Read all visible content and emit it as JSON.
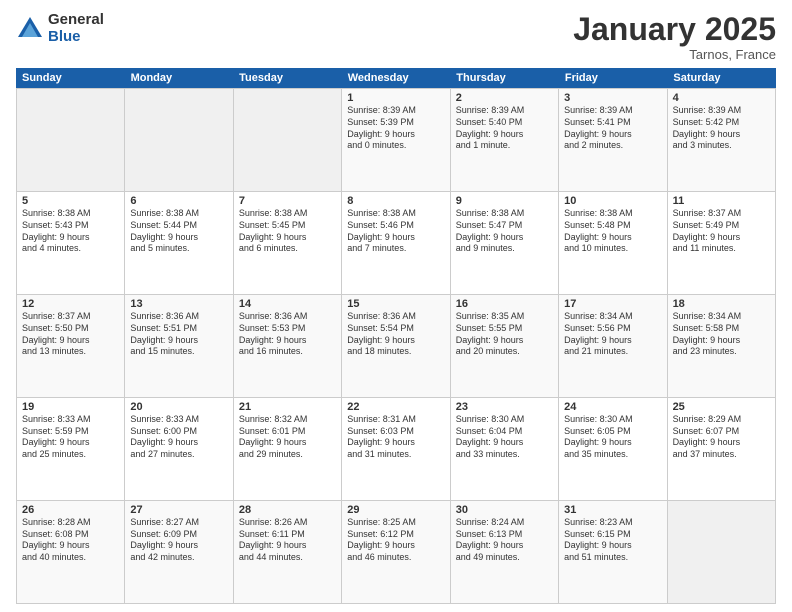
{
  "logo": {
    "general": "General",
    "blue": "Blue"
  },
  "header": {
    "month": "January 2025",
    "location": "Tarnos, France"
  },
  "weekdays": [
    "Sunday",
    "Monday",
    "Tuesday",
    "Wednesday",
    "Thursday",
    "Friday",
    "Saturday"
  ],
  "rows": [
    [
      {
        "day": "",
        "info": ""
      },
      {
        "day": "",
        "info": ""
      },
      {
        "day": "",
        "info": ""
      },
      {
        "day": "1",
        "info": "Sunrise: 8:39 AM\nSunset: 5:39 PM\nDaylight: 9 hours\nand 0 minutes."
      },
      {
        "day": "2",
        "info": "Sunrise: 8:39 AM\nSunset: 5:40 PM\nDaylight: 9 hours\nand 1 minute."
      },
      {
        "day": "3",
        "info": "Sunrise: 8:39 AM\nSunset: 5:41 PM\nDaylight: 9 hours\nand 2 minutes."
      },
      {
        "day": "4",
        "info": "Sunrise: 8:39 AM\nSunset: 5:42 PM\nDaylight: 9 hours\nand 3 minutes."
      }
    ],
    [
      {
        "day": "5",
        "info": "Sunrise: 8:38 AM\nSunset: 5:43 PM\nDaylight: 9 hours\nand 4 minutes."
      },
      {
        "day": "6",
        "info": "Sunrise: 8:38 AM\nSunset: 5:44 PM\nDaylight: 9 hours\nand 5 minutes."
      },
      {
        "day": "7",
        "info": "Sunrise: 8:38 AM\nSunset: 5:45 PM\nDaylight: 9 hours\nand 6 minutes."
      },
      {
        "day": "8",
        "info": "Sunrise: 8:38 AM\nSunset: 5:46 PM\nDaylight: 9 hours\nand 7 minutes."
      },
      {
        "day": "9",
        "info": "Sunrise: 8:38 AM\nSunset: 5:47 PM\nDaylight: 9 hours\nand 9 minutes."
      },
      {
        "day": "10",
        "info": "Sunrise: 8:38 AM\nSunset: 5:48 PM\nDaylight: 9 hours\nand 10 minutes."
      },
      {
        "day": "11",
        "info": "Sunrise: 8:37 AM\nSunset: 5:49 PM\nDaylight: 9 hours\nand 11 minutes."
      }
    ],
    [
      {
        "day": "12",
        "info": "Sunrise: 8:37 AM\nSunset: 5:50 PM\nDaylight: 9 hours\nand 13 minutes."
      },
      {
        "day": "13",
        "info": "Sunrise: 8:36 AM\nSunset: 5:51 PM\nDaylight: 9 hours\nand 15 minutes."
      },
      {
        "day": "14",
        "info": "Sunrise: 8:36 AM\nSunset: 5:53 PM\nDaylight: 9 hours\nand 16 minutes."
      },
      {
        "day": "15",
        "info": "Sunrise: 8:36 AM\nSunset: 5:54 PM\nDaylight: 9 hours\nand 18 minutes."
      },
      {
        "day": "16",
        "info": "Sunrise: 8:35 AM\nSunset: 5:55 PM\nDaylight: 9 hours\nand 20 minutes."
      },
      {
        "day": "17",
        "info": "Sunrise: 8:34 AM\nSunset: 5:56 PM\nDaylight: 9 hours\nand 21 minutes."
      },
      {
        "day": "18",
        "info": "Sunrise: 8:34 AM\nSunset: 5:58 PM\nDaylight: 9 hours\nand 23 minutes."
      }
    ],
    [
      {
        "day": "19",
        "info": "Sunrise: 8:33 AM\nSunset: 5:59 PM\nDaylight: 9 hours\nand 25 minutes."
      },
      {
        "day": "20",
        "info": "Sunrise: 8:33 AM\nSunset: 6:00 PM\nDaylight: 9 hours\nand 27 minutes."
      },
      {
        "day": "21",
        "info": "Sunrise: 8:32 AM\nSunset: 6:01 PM\nDaylight: 9 hours\nand 29 minutes."
      },
      {
        "day": "22",
        "info": "Sunrise: 8:31 AM\nSunset: 6:03 PM\nDaylight: 9 hours\nand 31 minutes."
      },
      {
        "day": "23",
        "info": "Sunrise: 8:30 AM\nSunset: 6:04 PM\nDaylight: 9 hours\nand 33 minutes."
      },
      {
        "day": "24",
        "info": "Sunrise: 8:30 AM\nSunset: 6:05 PM\nDaylight: 9 hours\nand 35 minutes."
      },
      {
        "day": "25",
        "info": "Sunrise: 8:29 AM\nSunset: 6:07 PM\nDaylight: 9 hours\nand 37 minutes."
      }
    ],
    [
      {
        "day": "26",
        "info": "Sunrise: 8:28 AM\nSunset: 6:08 PM\nDaylight: 9 hours\nand 40 minutes."
      },
      {
        "day": "27",
        "info": "Sunrise: 8:27 AM\nSunset: 6:09 PM\nDaylight: 9 hours\nand 42 minutes."
      },
      {
        "day": "28",
        "info": "Sunrise: 8:26 AM\nSunset: 6:11 PM\nDaylight: 9 hours\nand 44 minutes."
      },
      {
        "day": "29",
        "info": "Sunrise: 8:25 AM\nSunset: 6:12 PM\nDaylight: 9 hours\nand 46 minutes."
      },
      {
        "day": "30",
        "info": "Sunrise: 8:24 AM\nSunset: 6:13 PM\nDaylight: 9 hours\nand 49 minutes."
      },
      {
        "day": "31",
        "info": "Sunrise: 8:23 AM\nSunset: 6:15 PM\nDaylight: 9 hours\nand 51 minutes."
      },
      {
        "day": "",
        "info": ""
      }
    ]
  ]
}
